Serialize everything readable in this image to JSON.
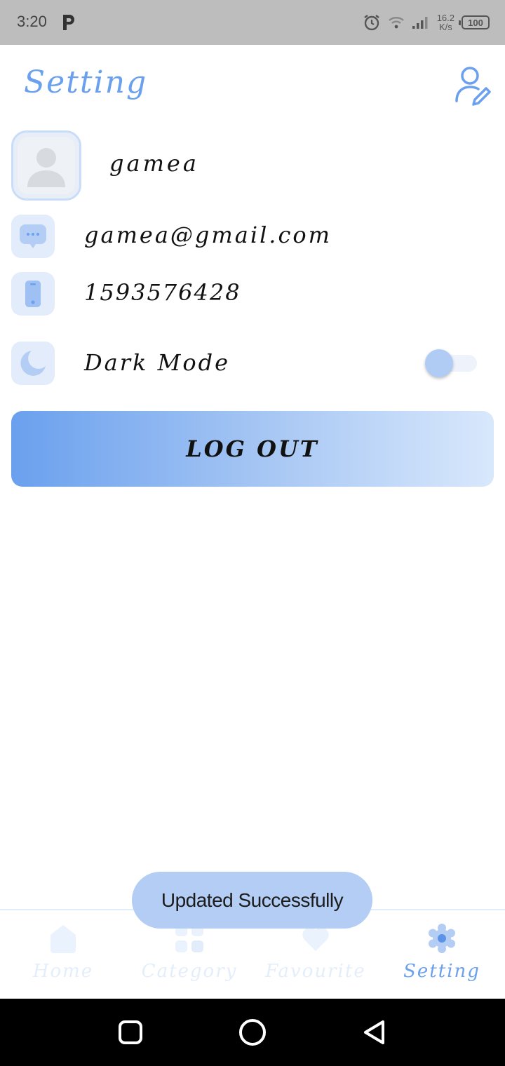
{
  "status_bar": {
    "time": "3:20",
    "speed_value": "16.2",
    "speed_unit": "K/s",
    "battery": "100",
    "icons": [
      "parking-p-icon",
      "alarm-icon",
      "wifi-icon",
      "signal-icon",
      "battery-icon"
    ]
  },
  "header": {
    "title": "Setting",
    "edit_icon": "user-edit-icon"
  },
  "profile": {
    "name": "gamea",
    "email": "gamea@gmail.com",
    "phone": "1593576428"
  },
  "dark_mode": {
    "label": "Dark Mode",
    "enabled": false
  },
  "logout_label": "LOG OUT",
  "toast": "Updated Successfully",
  "bottom_nav": {
    "items": [
      {
        "label": "Home",
        "icon": "home-icon",
        "active": false
      },
      {
        "label": "Category",
        "icon": "category-icon",
        "active": false
      },
      {
        "label": "Favourite",
        "icon": "heart-icon",
        "active": false
      },
      {
        "label": "Setting",
        "icon": "gear-icon",
        "active": true
      }
    ]
  },
  "colors": {
    "accent": "#6aa0ee",
    "light_accent": "#b3cdf4",
    "icon_bg": "#e3ecfa"
  }
}
